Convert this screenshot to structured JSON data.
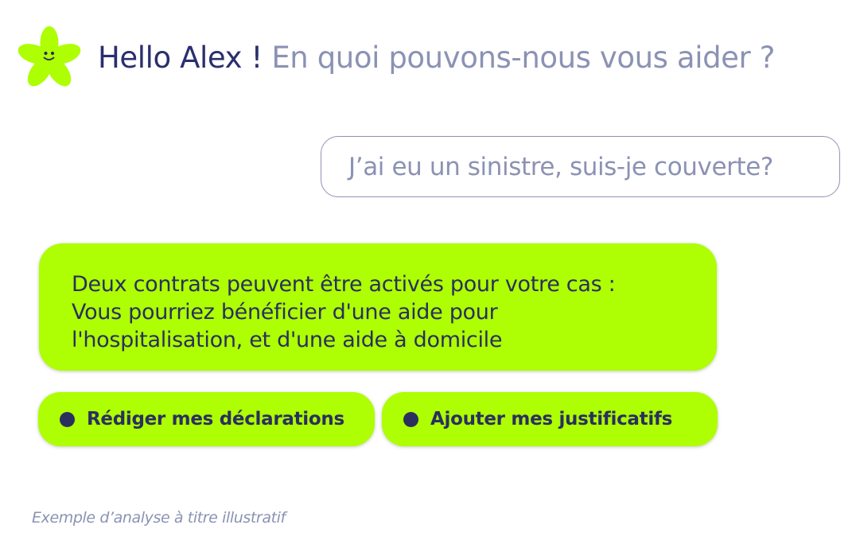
{
  "header": {
    "greeting": "Hello Alex !",
    "question": "En quoi pouvons-nous vous aider ?",
    "logo_icon": "flower-mascot-icon"
  },
  "chat": {
    "user_message": "J’ai eu un sinistre, suis-je couverte?",
    "bot_message_lines": [
      "Deux contrats peuvent être activés pour votre cas :",
      "Vous pourriez bénéficier d'une aide pour",
      "l'hospitalisation, et d'une aide à domicile"
    ]
  },
  "actions": [
    {
      "label": "Rédiger mes déclarations"
    },
    {
      "label": "Ajouter mes justificatifs"
    }
  ],
  "footer": {
    "disclaimer": "Exemple d’analyse à titre illustratif"
  },
  "colors": {
    "accent_lime": "#aefe04",
    "navy": "#2a2f6e",
    "muted_text": "#8b92b3"
  }
}
